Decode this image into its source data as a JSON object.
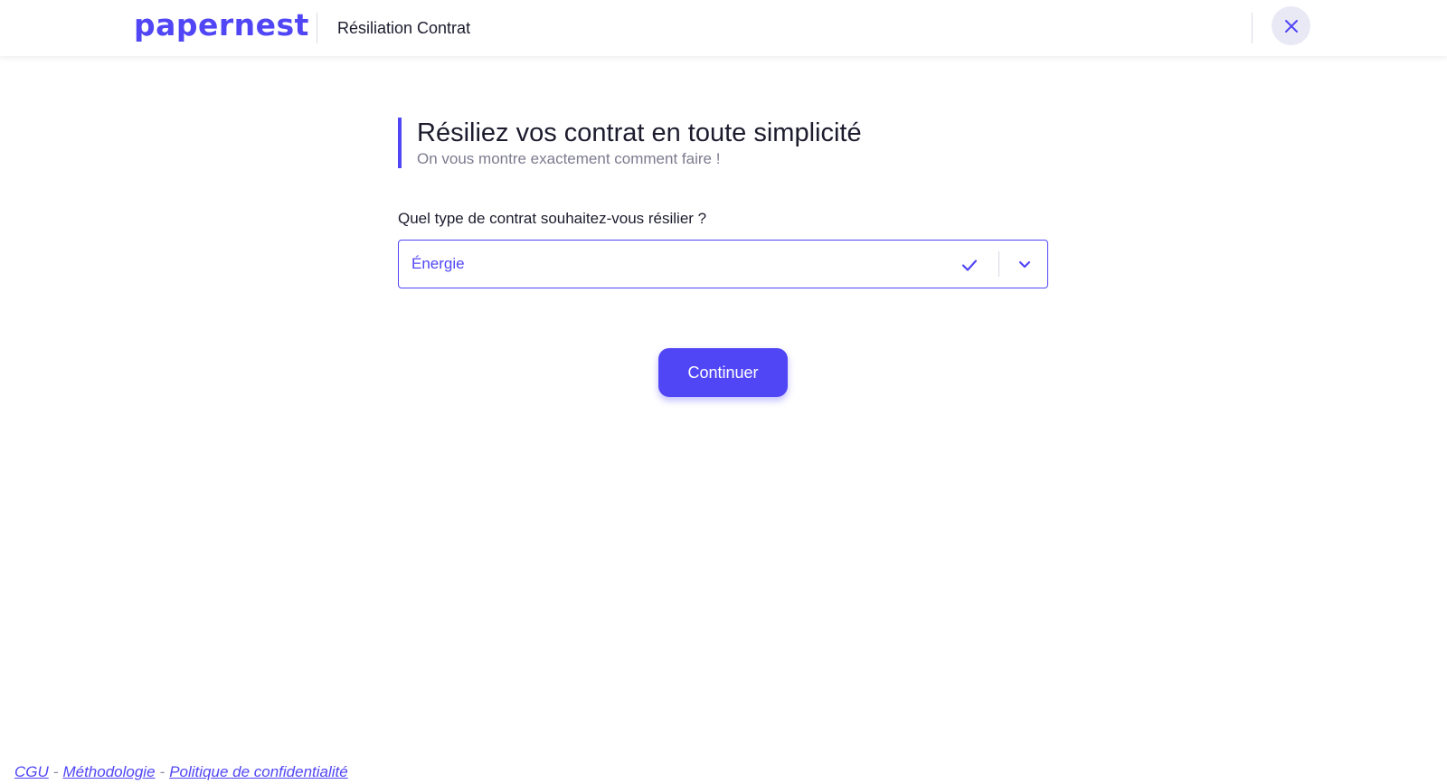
{
  "header": {
    "logo_text": "papernest",
    "title": "Résiliation Contrat",
    "close_icon": "close-icon"
  },
  "main": {
    "title": "Résiliez vos contrat en toute simplicité",
    "subtitle": "On vous montre exactement comment faire !",
    "contract_type": {
      "label": "Quel type de contrat souhaitez-vous résilier ?",
      "selected_value": "Énergie",
      "icons": [
        "check-icon",
        "chevron-down-icon"
      ]
    },
    "continue_label": "Continuer"
  },
  "footer": {
    "links": [
      "CGU",
      "Méthodologie",
      "Politique de confidentialité"
    ],
    "separator": "-"
  },
  "colors": {
    "accent": "#5146f5",
    "text": "#1c1c2e",
    "muted": "#7b7b8f",
    "close_bg": "#e9e9f6"
  }
}
